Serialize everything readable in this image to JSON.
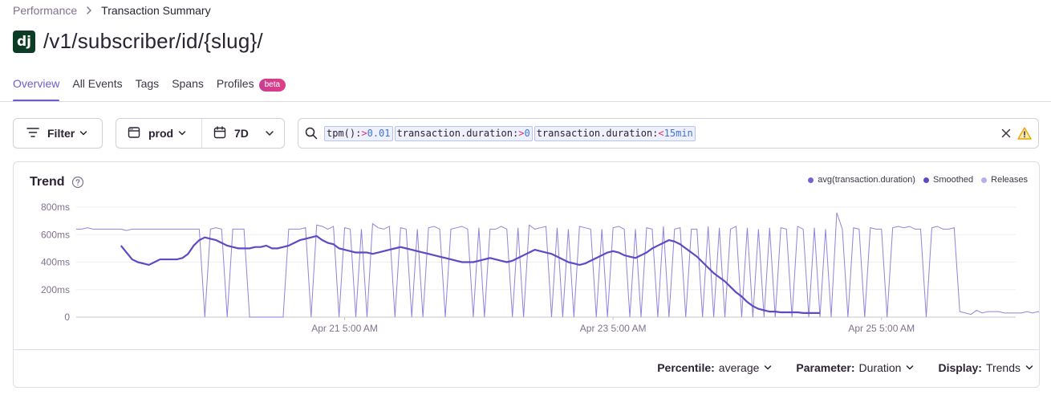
{
  "breadcrumb": {
    "parent": "Performance",
    "current": "Transaction Summary"
  },
  "header": {
    "platform_icon": "dj",
    "title": "/v1/subscriber/id/{slug}/"
  },
  "tabs": [
    {
      "label": "Overview",
      "active": true
    },
    {
      "label": "All Events",
      "active": false
    },
    {
      "label": "Tags",
      "active": false
    },
    {
      "label": "Spans",
      "active": false
    },
    {
      "label": "Profiles",
      "active": false,
      "badge": "beta"
    }
  ],
  "filters": {
    "filter_label": "Filter",
    "environment": "prod",
    "period": "7D",
    "search_tokens": [
      {
        "key": "tpm():",
        "op": ">",
        "value": "0.01"
      },
      {
        "key": "transaction.duration:",
        "op": ">",
        "value": "0"
      },
      {
        "key": "transaction.duration:",
        "op": "<",
        "value": "15min"
      }
    ]
  },
  "panel": {
    "title": "Trend",
    "legend": [
      {
        "label": "avg(transaction.duration)",
        "color": "#7163d1"
      },
      {
        "label": "Smoothed",
        "color": "#5b4bc4"
      },
      {
        "label": "Releases",
        "color": "#b7aeea"
      }
    ],
    "footer": {
      "percentile_label": "Percentile:",
      "percentile_value": "average",
      "parameter_label": "Parameter:",
      "parameter_value": "Duration",
      "display_label": "Display:",
      "display_value": "Trends"
    }
  },
  "colors": {
    "accent": "#6c5fc7",
    "raw_series": "#7b6fd3",
    "smoothed_series": "#5b4bc4",
    "axis_text": "#80708f"
  },
  "chart_data": {
    "type": "line",
    "y_unit": "ms",
    "ylim": [
      0,
      800
    ],
    "y_ticks": [
      "800ms",
      "600ms",
      "400ms",
      "200ms",
      "0"
    ],
    "x_tick_labels": [
      "Apr 21 5:00 AM",
      "Apr 23 5:00 AM",
      "Apr 25 5:00 AM"
    ],
    "x_tick_positions_hours": [
      48,
      96,
      144
    ],
    "x_range_hours": [
      0,
      168
    ],
    "series": [
      {
        "name": "avg(transaction.duration)",
        "step_hours": 1,
        "values": [
          640,
          640,
          650,
          640,
          640,
          640,
          640,
          640,
          640,
          630,
          640,
          640,
          640,
          640,
          640,
          640,
          640,
          640,
          640,
          640,
          640,
          640,
          640,
          0,
          640,
          650,
          640,
          0,
          640,
          640,
          640,
          0,
          0,
          0,
          0,
          0,
          0,
          0,
          640,
          640,
          640,
          650,
          0,
          670,
          660,
          640,
          660,
          0,
          650,
          640,
          0,
          640,
          0,
          680,
          650,
          640,
          660,
          0,
          650,
          640,
          0,
          640,
          0,
          650,
          660,
          640,
          0,
          640,
          650,
          660,
          640,
          0,
          650,
          0,
          640,
          640,
          660,
          640,
          0,
          650,
          0,
          670,
          640,
          650,
          660,
          0,
          650,
          0,
          640,
          0,
          660,
          650,
          640,
          0,
          640,
          0,
          650,
          660,
          640,
          0,
          640,
          0,
          650,
          640,
          0,
          660,
          0,
          640,
          650,
          0,
          640,
          640,
          0,
          660,
          0,
          650,
          0,
          640,
          660,
          0,
          650,
          0,
          640,
          0,
          650,
          0,
          650,
          640,
          0,
          660,
          640,
          0,
          650,
          0,
          640,
          0,
          760,
          640,
          0,
          650,
          640,
          0,
          650,
          640,
          640,
          0,
          650,
          660,
          650,
          660,
          640,
          640,
          0,
          650,
          660,
          640,
          640,
          650,
          40,
          30,
          20,
          50,
          30,
          40,
          40,
          40,
          30,
          30,
          30,
          30,
          40,
          30,
          40,
          30,
          30,
          30,
          30,
          30,
          30,
          30
        ],
        "smoothed": [
          520,
          470,
          420,
          400,
          390,
          380,
          400,
          420,
          420,
          420,
          420,
          430,
          460,
          520,
          560,
          580,
          570,
          560,
          540,
          520,
          510,
          500,
          500,
          500,
          510,
          510,
          520,
          500,
          500,
          510,
          520,
          540,
          560,
          570,
          580,
          590,
          560,
          540,
          530,
          500,
          490,
          480,
          470,
          470,
          470,
          460,
          470,
          480,
          490,
          500,
          510,
          500,
          490,
          480,
          470,
          460,
          450,
          440,
          430,
          420,
          410,
          400,
          400,
          400,
          410,
          420,
          430,
          420,
          410,
          400,
          410,
          430,
          450,
          470,
          490,
          480,
          470,
          460,
          440,
          420,
          400,
          390,
          380,
          390,
          410,
          430,
          450,
          470,
          480,
          470,
          450,
          440,
          430,
          450,
          470,
          500,
          520,
          540,
          560,
          550,
          530,
          500,
          470,
          440,
          400,
          360,
          320,
          290,
          260,
          220,
          180,
          150,
          110,
          80,
          60,
          50,
          40,
          40,
          35,
          35,
          35,
          35,
          30,
          30,
          30,
          30
        ],
        "smoothed_start_hour": 8
      }
    ]
  }
}
